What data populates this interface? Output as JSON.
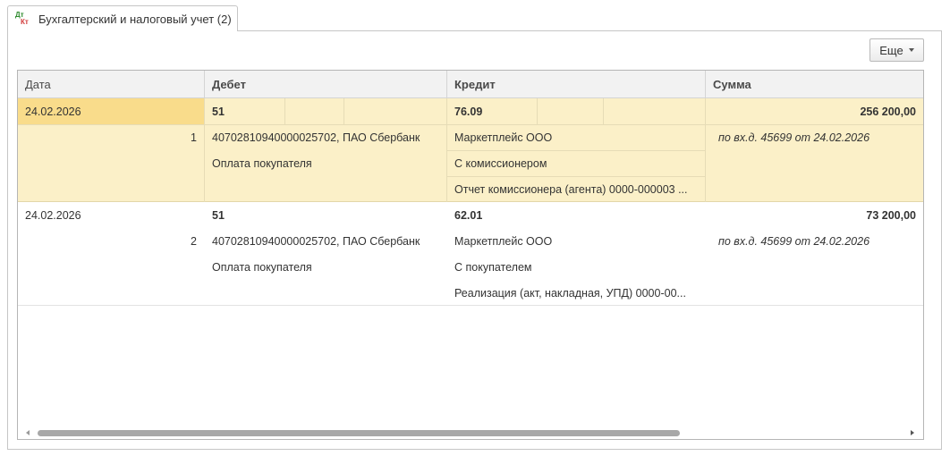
{
  "tab": {
    "icon": "dt-kt-ledger-icon",
    "icon_top": "Дт",
    "icon_bottom": "Кт",
    "label": "Бухгалтерский и налоговый учет (2)"
  },
  "toolbar": {
    "more_label": "Еще"
  },
  "table": {
    "headers": {
      "date": "Дата",
      "debit": "Дебет",
      "credit": "Кредит",
      "sum": "Сумма"
    },
    "rows": [
      {
        "selected": true,
        "date": "24.02.2026",
        "number": "1",
        "debit_account": "51",
        "debit_sub1": "40702810940000025702, ПАО Сбербанк",
        "debit_sub2": "Оплата покупателя",
        "credit_account": "76.09",
        "credit_sub1": "Маркетплейс ООО",
        "credit_sub2": "С комиссионером",
        "credit_sub3": "Отчет комиссионера (агента) 0000-000003 ...",
        "sum": "256 200,00",
        "content": "по вх.д. 45699 от 24.02.2026"
      },
      {
        "selected": false,
        "date": "24.02.2026",
        "number": "2",
        "debit_account": "51",
        "debit_sub1": "40702810940000025702, ПАО Сбербанк",
        "debit_sub2": "Оплата покупателя",
        "credit_account": "62.01",
        "credit_sub1": "Маркетплейс ООО",
        "credit_sub2": "С покупателем",
        "credit_sub3": "Реализация (акт, накладная, УПД) 0000-00...",
        "sum": "73 200,00",
        "content": "по вх.д. 45699 от 24.02.2026"
      }
    ]
  },
  "scrollbar": {
    "position": 0.0
  }
}
